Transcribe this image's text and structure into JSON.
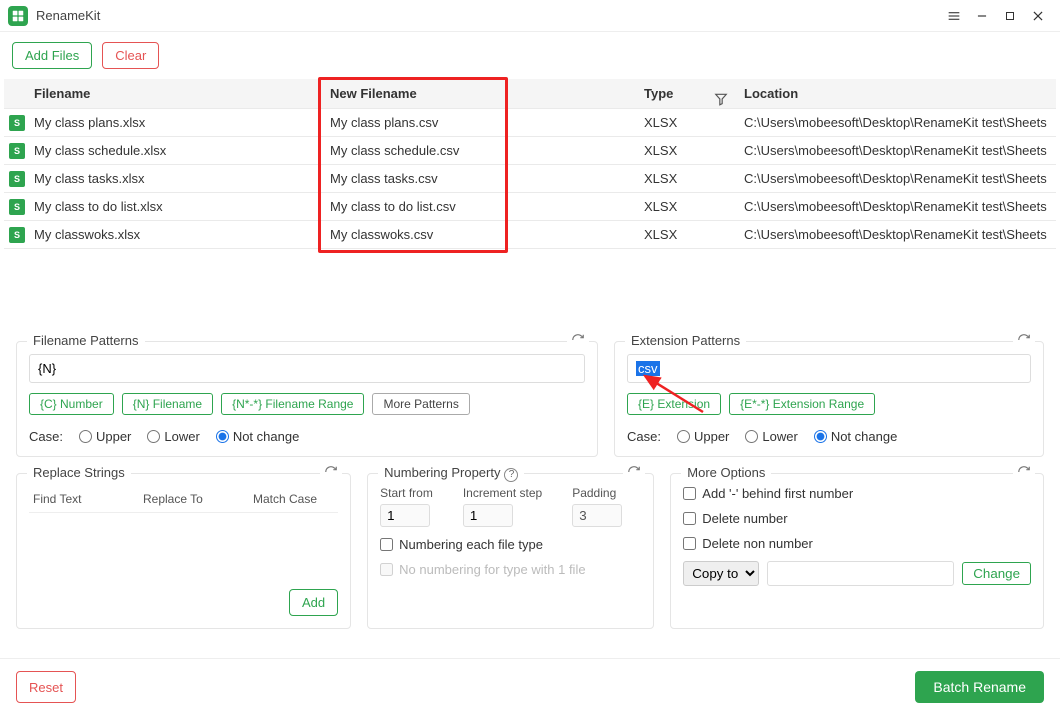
{
  "app": {
    "title": "RenameKit"
  },
  "toolbar": {
    "add_files": "Add Files",
    "clear": "Clear"
  },
  "grid": {
    "headers": {
      "filename": "Filename",
      "new_filename": "New Filename",
      "type": "Type",
      "location": "Location"
    },
    "rows": [
      {
        "filename": "My class plans.xlsx",
        "new_filename": "My class plans.csv",
        "type": "XLSX",
        "location": "C:\\Users\\mobeesoft\\Desktop\\RenameKit test\\Sheets"
      },
      {
        "filename": "My class schedule.xlsx",
        "new_filename": "My class schedule.csv",
        "type": "XLSX",
        "location": "C:\\Users\\mobeesoft\\Desktop\\RenameKit test\\Sheets"
      },
      {
        "filename": "My class tasks.xlsx",
        "new_filename": "My class tasks.csv",
        "type": "XLSX",
        "location": "C:\\Users\\mobeesoft\\Desktop\\RenameKit test\\Sheets"
      },
      {
        "filename": "My class to do list.xlsx",
        "new_filename": "My class to do list.csv",
        "type": "XLSX",
        "location": "C:\\Users\\mobeesoft\\Desktop\\RenameKit test\\Sheets"
      },
      {
        "filename": "My classwoks.xlsx",
        "new_filename": "My classwoks.csv",
        "type": "XLSX",
        "location": "C:\\Users\\mobeesoft\\Desktop\\RenameKit test\\Sheets"
      }
    ]
  },
  "filename_patterns": {
    "title": "Filename Patterns",
    "value": "{N}",
    "chips": {
      "number": "{C} Number",
      "filename": "{N} Filename",
      "range": "{N*-*} Filename Range",
      "more": "More Patterns"
    },
    "case": {
      "label": "Case:",
      "upper": "Upper",
      "lower": "Lower",
      "notchange": "Not change"
    }
  },
  "extension_patterns": {
    "title": "Extension Patterns",
    "value": "csv",
    "chips": {
      "ext": "{E} Extension",
      "range": "{E*-*} Extension Range"
    },
    "case": {
      "label": "Case:",
      "upper": "Upper",
      "lower": "Lower",
      "notchange": "Not change"
    }
  },
  "replace": {
    "title": "Replace Strings",
    "cols": {
      "find": "Find Text",
      "replace": "Replace To",
      "match": "Match Case"
    },
    "add": "Add"
  },
  "numbering": {
    "title": "Numbering Property",
    "start_label": "Start from",
    "start_value": "1",
    "step_label": "Increment step",
    "step_value": "1",
    "pad_label": "Padding",
    "pad_value": "3",
    "chk_each": "Numbering each file type",
    "chk_noone": "No numbering for type with 1 file"
  },
  "more": {
    "title": "More Options",
    "chk_dash": "Add '-' behind first number",
    "chk_delnum": "Delete number",
    "chk_delnon": "Delete non number",
    "copy_label": "Copy to",
    "change": "Change"
  },
  "footer": {
    "reset": "Reset",
    "batch": "Batch Rename"
  },
  "icons": {
    "xlsx_glyph": "S"
  }
}
